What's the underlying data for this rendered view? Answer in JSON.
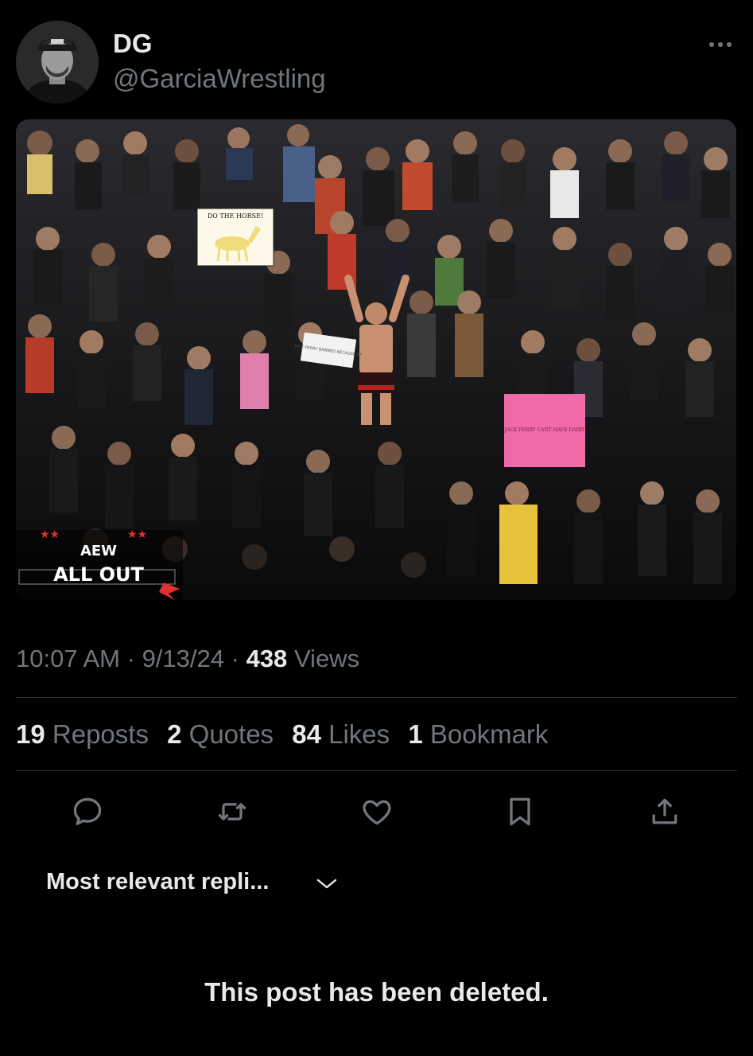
{
  "post": {
    "author": {
      "display_name": "DG",
      "handle": "@GarciaWrestling"
    },
    "media": {
      "signs": {
        "horse_sign": "DO THE HORSE!",
        "pink_sign": "JACK PERRY CANT HAVE DAIRY",
        "white_sign": "JACK PERRY BANNED BECAUSE OF"
      },
      "logo": {
        "brand": "AEW",
        "event": "ALL OUT"
      }
    },
    "time": "10:07 AM",
    "date": "9/13/24",
    "separator": "·",
    "views_count": "438",
    "views_label": "Views"
  },
  "stats": [
    {
      "count": "19",
      "label": "Reposts"
    },
    {
      "count": "2",
      "label": "Quotes"
    },
    {
      "count": "84",
      "label": "Likes"
    },
    {
      "count": "1",
      "label": "Bookmark"
    }
  ],
  "actions": [
    {
      "icon": "reply-icon"
    },
    {
      "icon": "repost-icon"
    },
    {
      "icon": "like-icon"
    },
    {
      "icon": "bookmark-icon"
    },
    {
      "icon": "share-icon"
    }
  ],
  "replies": {
    "sort_label": "Most relevant repli...",
    "deleted_notice": "This post has been deleted."
  },
  "colors": {
    "background": "#000000",
    "text_primary": "#e7e9ea",
    "text_secondary": "#71767b",
    "divider": "#2f3336",
    "pink_sign": "#f06aa8",
    "horse_sign": "#fdf8e8"
  }
}
